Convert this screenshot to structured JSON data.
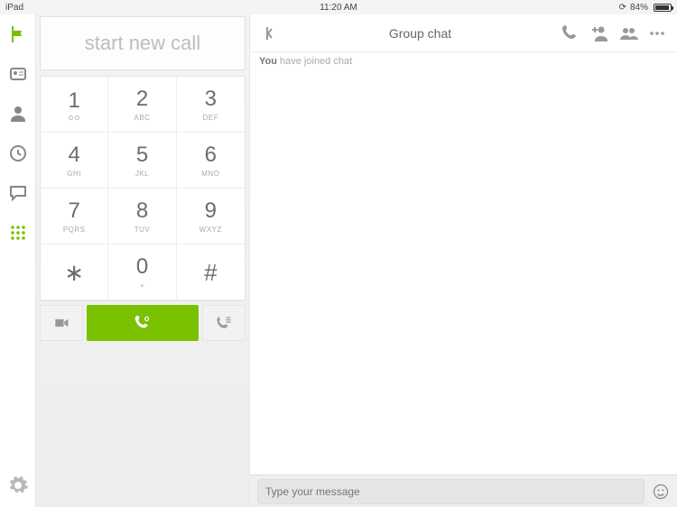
{
  "status": {
    "device": "iPad",
    "time": "11:20 AM",
    "battery_pct": "84%"
  },
  "sidebar": {
    "items": [
      {
        "name": "flag",
        "active": true
      },
      {
        "name": "contacts-card",
        "active": false
      },
      {
        "name": "presence",
        "active": false
      },
      {
        "name": "history",
        "active": false
      },
      {
        "name": "chat",
        "active": false
      },
      {
        "name": "dialpad",
        "active": true
      }
    ]
  },
  "dialer": {
    "placeholder": "start new call",
    "keys": [
      {
        "digit": "1",
        "letters": "",
        "vm": true
      },
      {
        "digit": "2",
        "letters": "ABC"
      },
      {
        "digit": "3",
        "letters": "DEF"
      },
      {
        "digit": "4",
        "letters": "GHI"
      },
      {
        "digit": "5",
        "letters": "JKL"
      },
      {
        "digit": "6",
        "letters": "MNO"
      },
      {
        "digit": "7",
        "letters": "PQRS"
      },
      {
        "digit": "8",
        "letters": "TUV"
      },
      {
        "digit": "9",
        "letters": "WXYZ"
      },
      {
        "digit": "∗",
        "letters": "",
        "symbol": true
      },
      {
        "digit": "0",
        "letters": "+"
      },
      {
        "digit": "#",
        "letters": "",
        "symbol": true
      }
    ]
  },
  "chat": {
    "title": "Group chat",
    "status_bold": "You",
    "status_rest": " have joined chat",
    "input_placeholder": "Type your message"
  },
  "colors": {
    "accent": "#7ac200"
  }
}
